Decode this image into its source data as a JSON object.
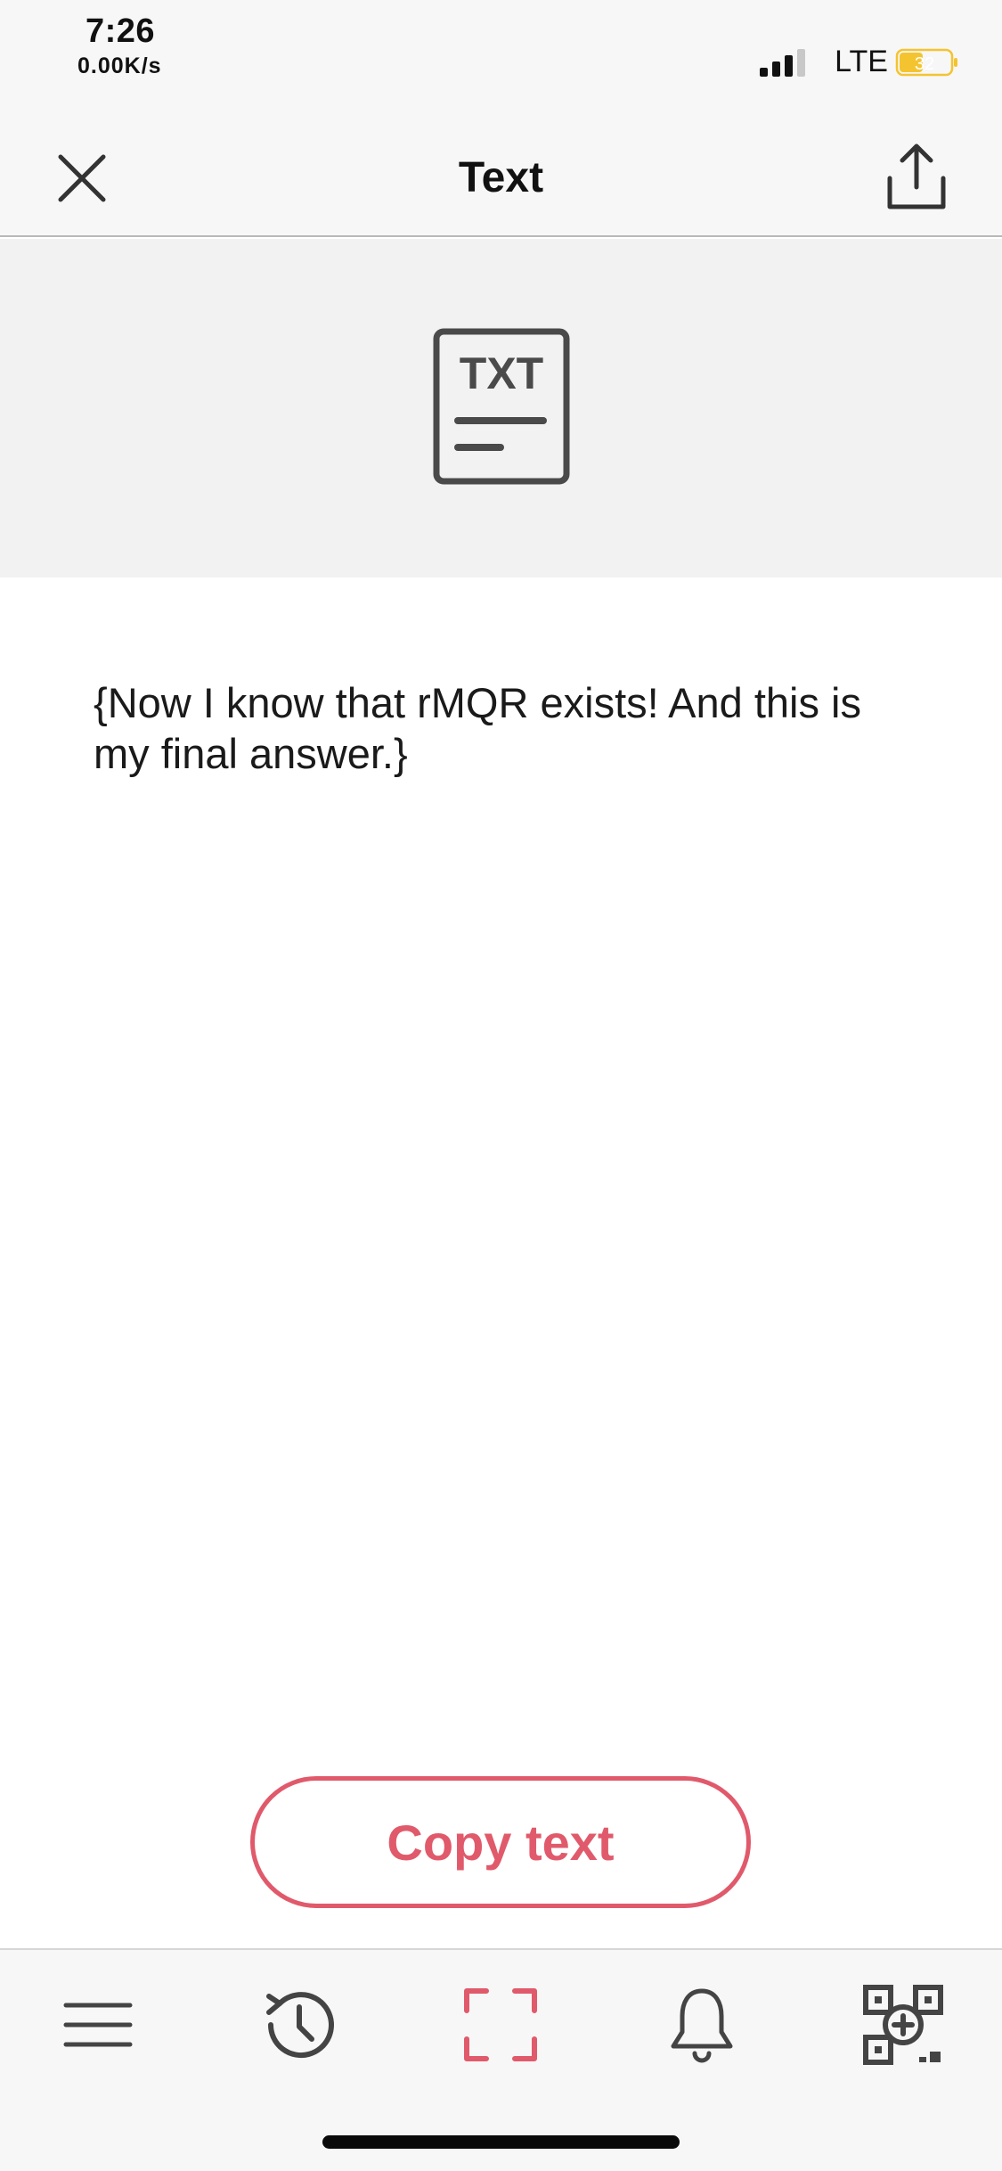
{
  "status_bar": {
    "time": "7:26",
    "network_speed": "0.00K/s",
    "carrier": "LTE",
    "battery_level": "32",
    "battery_color": "#f4c430"
  },
  "nav": {
    "title": "Text",
    "close_icon": "close-icon",
    "share_icon": "share-icon"
  },
  "header": {
    "icon": "txt-document-icon",
    "icon_label": "TXT"
  },
  "content": {
    "text": "{Now I know that rMQR exists! And this is my final answer.}"
  },
  "actions": {
    "copy_label": "Copy text",
    "accent_color": "#e05a6b"
  },
  "tab_bar": {
    "items": [
      {
        "icon": "menu-icon",
        "active": false
      },
      {
        "icon": "history-icon",
        "active": false
      },
      {
        "icon": "scan-icon",
        "active": true
      },
      {
        "icon": "bell-icon",
        "active": false
      },
      {
        "icon": "qr-create-icon",
        "active": false
      }
    ]
  }
}
